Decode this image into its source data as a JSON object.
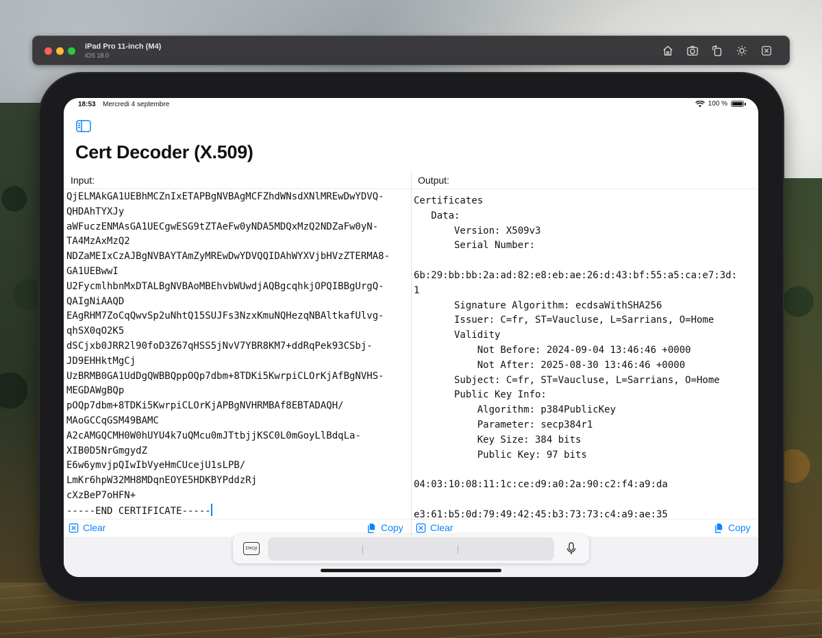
{
  "simulator": {
    "device_name": "iPad Pro 11-inch (M4)",
    "os_version": "iOS 18.0",
    "toolbar_icons": [
      "home-icon",
      "screenshot-icon",
      "rotate-icon",
      "appearance-icon",
      "shake-icon"
    ]
  },
  "status_bar": {
    "time": "18:53",
    "date": "Mercredi 4 septembre",
    "battery": "100 %"
  },
  "app": {
    "title": "Cert Decoder (X.509)",
    "input_label": "Input:",
    "output_label": "Output:",
    "input_lines": [
      "QjELMAkGA1UEBhMCZnIxETAPBgNVBAgMCFZhdWNsdXNlMREwDwYDVQ-",
      "QHDAhTYXJy",
      "aWFuczENMAsGA1UECgwESG9tZTAeFw0yNDA5MDQxMzQ2NDZaFw0yN-",
      "TA4MzAxMzQ2",
      "NDZaMEIxCzAJBgNVBAYTAmZyMREwDwYDVQQIDAhWYXVjbHVzZTERMA8-",
      "GA1UEBwwI",
      "U2FycmlhbnMxDTALBgNVBAoMBEhvbWUwdjAQBgcqhkjOPQIBBgUrgQ-",
      "QAIgNiAAQD",
      "EAgRHM7ZoCqQwvSp2uNhtQ15SUJFs3NzxKmuNQHezqNBAltkafUlvg-",
      "qhSX0qO2K5",
      "dSCjxb0JRR2l90foD3Z67qHSS5jNvV7YBR8KM7+ddRqPek93CSbj-",
      "JD9EHHktMgCj",
      "UzBRMB0GA1UdDgQWBBQppOQp7dbm+8TDKi5KwrpiCLOrKjAfBgNVHS-",
      "MEGDAWgBQp",
      "pOQp7dbm+8TDKi5KwrpiCLOrKjAPBgNVHRMBAf8EBTADAQH/",
      "MAoGCCqGSM49BAMC",
      "A2cAMGQCMH0W0hUYU4k7uQMcu0mJTtbjjKSC0L0mGoyLlBdqLa-",
      "XIB0D5NrGmgydZ",
      "E6w6ymvjpQIwIbVyeHmCUcejU1sLPB/",
      "LmKr6hpW32MH8MDqnEOYE5HDKBYPddzRj",
      "cXzBeP7oHFN+",
      "-----END CERTIFICATE-----"
    ],
    "output_lines": [
      "Certificates",
      "   Data:",
      "       Version: X509v3",
      "       Serial Number:",
      "",
      "6b:29:bb:bb:2a:ad:82:e8:eb:ae:26:d:43:bf:55:a5:ca:e7:3d:",
      "1",
      "       Signature Algorithm: ecdsaWithSHA256",
      "       Issuer: C=fr, ST=Vaucluse, L=Sarrians, O=Home",
      "       Validity",
      "           Not Before: 2024-09-04 13:46:46 +0000",
      "           Not After: 2025-08-30 13:46:46 +0000",
      "       Subject: C=fr, ST=Vaucluse, L=Sarrians, O=Home",
      "       Public Key Info:",
      "           Algorithm: p384PublicKey",
      "           Parameter: secp384r1",
      "           Key Size: 384 bits",
      "           Public Key: 97 bits",
      "",
      "04:03:10:08:11:1c:ce:d9:a0:2a:90:c2:f4:a9:da",
      "",
      "e3:61:b5:0d:79:49:42:45:b3:73:73:c4:a9:ae:35"
    ],
    "input_actions": {
      "clear_label": "Clear",
      "copy_label": "Copy"
    },
    "output_actions": {
      "clear_label": "Clear",
      "copy_label": "Copy"
    }
  },
  "keyboard_bar": {
    "emoji_key_label": "EMOJI",
    "field_placeholder": ""
  },
  "colors": {
    "accent": "#0a84ff",
    "caret": "#0a84ff"
  }
}
